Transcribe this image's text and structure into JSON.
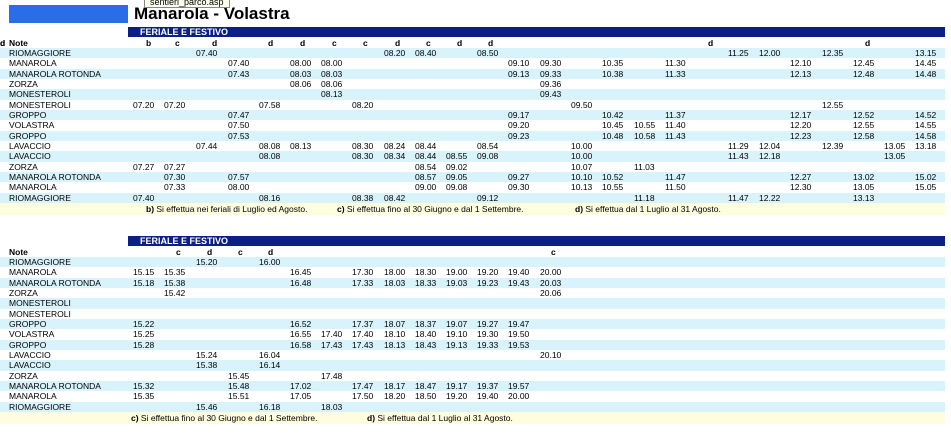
{
  "header": {
    "title": "Manarola - Volastra",
    "tooltip": "sentieri_parco.asp"
  },
  "tables": [
    {
      "section": "FERIALE E FESTIVO",
      "note_label": "Note",
      "notes": [
        [
          "b",
          "c",
          "d",
          "",
          "d",
          "d",
          "c",
          "c",
          "d",
          "c",
          "d",
          "d",
          "",
          "",
          "",
          "",
          "",
          "",
          "",
          "d",
          "d",
          "",
          "",
          "d",
          "d"
        ]
      ],
      "note_cols": [
        146,
        175,
        212,
        0,
        268,
        300,
        332,
        363,
        395,
        426,
        457,
        488,
        0,
        0,
        0,
        0,
        0,
        0,
        0,
        0,
        708,
        740,
        0,
        0,
        865,
        897
      ],
      "cols": [
        133,
        164,
        196,
        228,
        259,
        290,
        321,
        352,
        384,
        415,
        446,
        477,
        508,
        540,
        571,
        602,
        634,
        665,
        696,
        728,
        759,
        790,
        822,
        853,
        884,
        915
      ],
      "rows": [
        [
          "RIOMAGGIORE",
          "",
          "",
          "07.40",
          "",
          "",
          "",
          "",
          "",
          "08.20",
          "08.40",
          "",
          "08.50",
          "",
          "",
          "",
          "",
          "",
          "",
          "",
          "11.25",
          "12.00",
          "",
          "12.35",
          "",
          "",
          "13.15"
        ],
        [
          "MANAROLA",
          "",
          "",
          "",
          "07.40",
          "",
          "08.00",
          "08.00",
          "",
          "",
          "",
          "",
          "",
          "09.10",
          "09.30",
          "",
          "10.35",
          "",
          "11.30",
          "",
          "",
          "",
          "12.10",
          "",
          "12.45",
          "",
          "14.45"
        ],
        [
          "MANAROLA ROTONDA",
          "",
          "",
          "",
          "07.43",
          "",
          "08.03",
          "08.03",
          "",
          "",
          "",
          "",
          "",
          "09.13",
          "09.33",
          "",
          "10.38",
          "",
          "11.33",
          "",
          "",
          "",
          "12.13",
          "",
          "12.48",
          "",
          "14.48"
        ],
        [
          "ZORZA",
          "",
          "",
          "",
          "",
          "",
          "08.06",
          "08.06",
          "",
          "",
          "",
          "",
          "",
          "",
          "09.36",
          "",
          "",
          "",
          "",
          "",
          "",
          "",
          "",
          "",
          "",
          "",
          ""
        ],
        [
          "MONESTEROLI",
          "",
          "",
          "",
          "",
          "",
          "",
          "08.13",
          "",
          "",
          "",
          "",
          "",
          "",
          "09.43",
          "",
          "",
          "",
          "",
          "",
          "",
          "",
          "",
          "",
          "",
          "",
          ""
        ],
        [
          "MONESTEROLI",
          "07.20",
          "07.20",
          "",
          "",
          "07.58",
          "",
          "",
          "08.20",
          "",
          "",
          "",
          "",
          "",
          "",
          "09.50",
          "",
          "",
          "",
          "",
          "",
          "",
          "",
          "12.55",
          "",
          "",
          ""
        ],
        [
          "GROPPO",
          "",
          "",
          "",
          "07.47",
          "",
          "",
          "",
          "",
          "",
          "",
          "",
          "",
          "09.17",
          "",
          "",
          "10.42",
          "",
          "11.37",
          "",
          "",
          "",
          "12.17",
          "",
          "12.52",
          "",
          "14.52"
        ],
        [
          "VOLASTRA",
          "",
          "",
          "",
          "07.50",
          "",
          "",
          "",
          "",
          "",
          "",
          "",
          "",
          "09.20",
          "",
          "",
          "10.45",
          "10.55",
          "11.40",
          "",
          "",
          "",
          "12.20",
          "",
          "12.55",
          "",
          "14.55"
        ],
        [
          "GROPPO",
          "",
          "",
          "",
          "07.53",
          "",
          "",
          "",
          "",
          "",
          "",
          "",
          "",
          "09.23",
          "",
          "",
          "10.48",
          "10.58",
          "11.43",
          "",
          "",
          "",
          "12.23",
          "",
          "12.58",
          "",
          "14.58"
        ],
        [
          "LAVACCIO",
          "",
          "",
          "07.44",
          "",
          "08.08",
          "08.13",
          "",
          "08.30",
          "08.24",
          "08.44",
          "",
          "08.54",
          "",
          "",
          "10.00",
          "",
          "",
          "",
          "",
          "11.29",
          "12.04",
          "",
          "12.39",
          "",
          "13.05",
          "13.18"
        ],
        [
          "LAVACCIO",
          "",
          "",
          "",
          "",
          "08.08",
          "",
          "",
          "08.30",
          "08.34",
          "08.44",
          "08.55",
          "09.08",
          "",
          "",
          "10.00",
          "",
          "",
          "",
          "",
          "11.43",
          "12.18",
          "",
          "",
          "",
          "13.05",
          ""
        ],
        [
          "ZORZA",
          "07.27",
          "07.27",
          "",
          "",
          "",
          "",
          "",
          "",
          "",
          "08.54",
          "09.02",
          "",
          "",
          "",
          "10.07",
          "",
          "11.03",
          "",
          "",
          "",
          "",
          "",
          "",
          "",
          "",
          ""
        ],
        [
          "MANAROLA ROTONDA",
          "",
          "07.30",
          "",
          "07.57",
          "",
          "",
          "",
          "",
          "",
          "08.57",
          "09.05",
          "",
          "09.27",
          "",
          "10.10",
          "10.52",
          "",
          "11.47",
          "",
          "",
          "",
          "12.27",
          "",
          "13.02",
          "",
          "15.02"
        ],
        [
          "MANAROLA",
          "",
          "07.33",
          "",
          "08.00",
          "",
          "",
          "",
          "",
          "",
          "09.00",
          "09.08",
          "",
          "09.30",
          "",
          "10.13",
          "10.55",
          "",
          "11.50",
          "",
          "",
          "",
          "12.30",
          "",
          "13.05",
          "",
          "15.05"
        ],
        [
          "RIOMAGGIORE",
          "07.40",
          "",
          "",
          "",
          "08.16",
          "",
          "",
          "08.38",
          "08.42",
          "",
          "",
          "09.12",
          "",
          "",
          "",
          "",
          "11.18",
          "",
          "",
          "11.47",
          "12.22",
          "",
          "",
          "13.13",
          "",
          ""
        ]
      ],
      "footnotes": [
        {
          "key": "b)",
          "text": "Si effettua nei feriali di Luglio ed Agosto."
        },
        {
          "key": "c)",
          "text": "Si effettua fino al 30 Giugno e dal 1 Settembre."
        },
        {
          "key": "d)",
          "text": "Si effettua dal 1 Luglio al 31 Agosto."
        }
      ]
    },
    {
      "section": "FERIALE E FESTIVO",
      "note_label": "Note",
      "notes": [
        [
          "",
          "c",
          "d",
          "c",
          "d",
          "",
          "",
          "",
          "",
          "",
          "",
          "",
          "",
          "",
          "c"
        ]
      ],
      "note_cols": [
        0,
        176,
        207,
        238,
        268,
        0,
        0,
        0,
        0,
        0,
        0,
        0,
        0,
        0,
        551
      ],
      "cols": [
        133,
        164,
        196,
        228,
        259,
        290,
        321,
        352,
        384,
        415,
        446,
        477,
        508,
        540
      ],
      "rows": [
        [
          "RIOMAGGIORE",
          "",
          "",
          "15.20",
          "",
          "16.00",
          "",
          "",
          "",
          "",
          "",
          "",
          "",
          "",
          ""
        ],
        [
          "MANAROLA",
          "15.15",
          "15.35",
          "",
          "",
          "",
          "16.45",
          "",
          "17.30",
          "18.00",
          "18.30",
          "19.00",
          "19.20",
          "19.40",
          "20.00"
        ],
        [
          "MANAROLA ROTONDA",
          "15.18",
          "15.38",
          "",
          "",
          "",
          "16.48",
          "",
          "17.33",
          "18.03",
          "18.33",
          "19.03",
          "19.23",
          "19.43",
          "20.03"
        ],
        [
          "ZORZA",
          "",
          "15.42",
          "",
          "",
          "",
          "",
          "",
          "",
          "",
          "",
          "",
          "",
          "",
          "20.06"
        ],
        [
          "MONESTEROLI",
          "",
          "",
          "",
          "",
          "",
          "",
          "",
          "",
          "",
          "",
          "",
          "",
          "",
          ""
        ],
        [
          "MONESTEROLI",
          "",
          "",
          "",
          "",
          "",
          "",
          "",
          "",
          "",
          "",
          "",
          "",
          "",
          ""
        ],
        [
          "GROPPO",
          "15.22",
          "",
          "",
          "",
          "",
          "16.52",
          "",
          "17.37",
          "18.07",
          "18.37",
          "19.07",
          "19.27",
          "19.47",
          ""
        ],
        [
          "VOLASTRA",
          "15.25",
          "",
          "",
          "",
          "",
          "16.55",
          "17.40",
          "17.40",
          "18.10",
          "18.40",
          "19.10",
          "19.30",
          "19.50",
          ""
        ],
        [
          "GROPPO",
          "15.28",
          "",
          "",
          "",
          "",
          "16.58",
          "17.43",
          "17.43",
          "18.13",
          "18.43",
          "19.13",
          "19.33",
          "19.53",
          ""
        ],
        [
          "LAVACCIO",
          "",
          "",
          "15.24",
          "",
          "16.04",
          "",
          "",
          "",
          "",
          "",
          "",
          "",
          "",
          "20.10"
        ],
        [
          "LAVACCIO",
          "",
          "",
          "15.38",
          "",
          "16.14",
          "",
          "",
          "",
          "",
          "",
          "",
          "",
          "",
          ""
        ],
        [
          "ZORZA",
          "",
          "",
          "",
          "15.45",
          "",
          "",
          "17.48",
          "",
          "",
          "",
          "",
          "",
          "",
          ""
        ],
        [
          "MANAROLA ROTONDA",
          "15.32",
          "",
          "",
          "15.48",
          "",
          "17.02",
          "",
          "17.47",
          "18.17",
          "18.47",
          "19.17",
          "19.37",
          "19.57",
          ""
        ],
        [
          "MANAROLA",
          "15.35",
          "",
          "",
          "15.51",
          "",
          "17.05",
          "",
          "17.50",
          "18.20",
          "18.50",
          "19.20",
          "19.40",
          "20.00",
          ""
        ],
        [
          "RIOMAGGIORE",
          "",
          "",
          "15.46",
          "",
          "16.18",
          "",
          "18.03",
          "",
          "",
          "",
          "",
          "",
          "",
          ""
        ]
      ],
      "footnotes": [
        {
          "key": "c)",
          "text": "Si effettua fino al 30 Giugno e dal 1 Settembre."
        },
        {
          "key": "d)",
          "text": "Si effettua dal 1 Luglio al 31 Agosto."
        }
      ]
    }
  ]
}
